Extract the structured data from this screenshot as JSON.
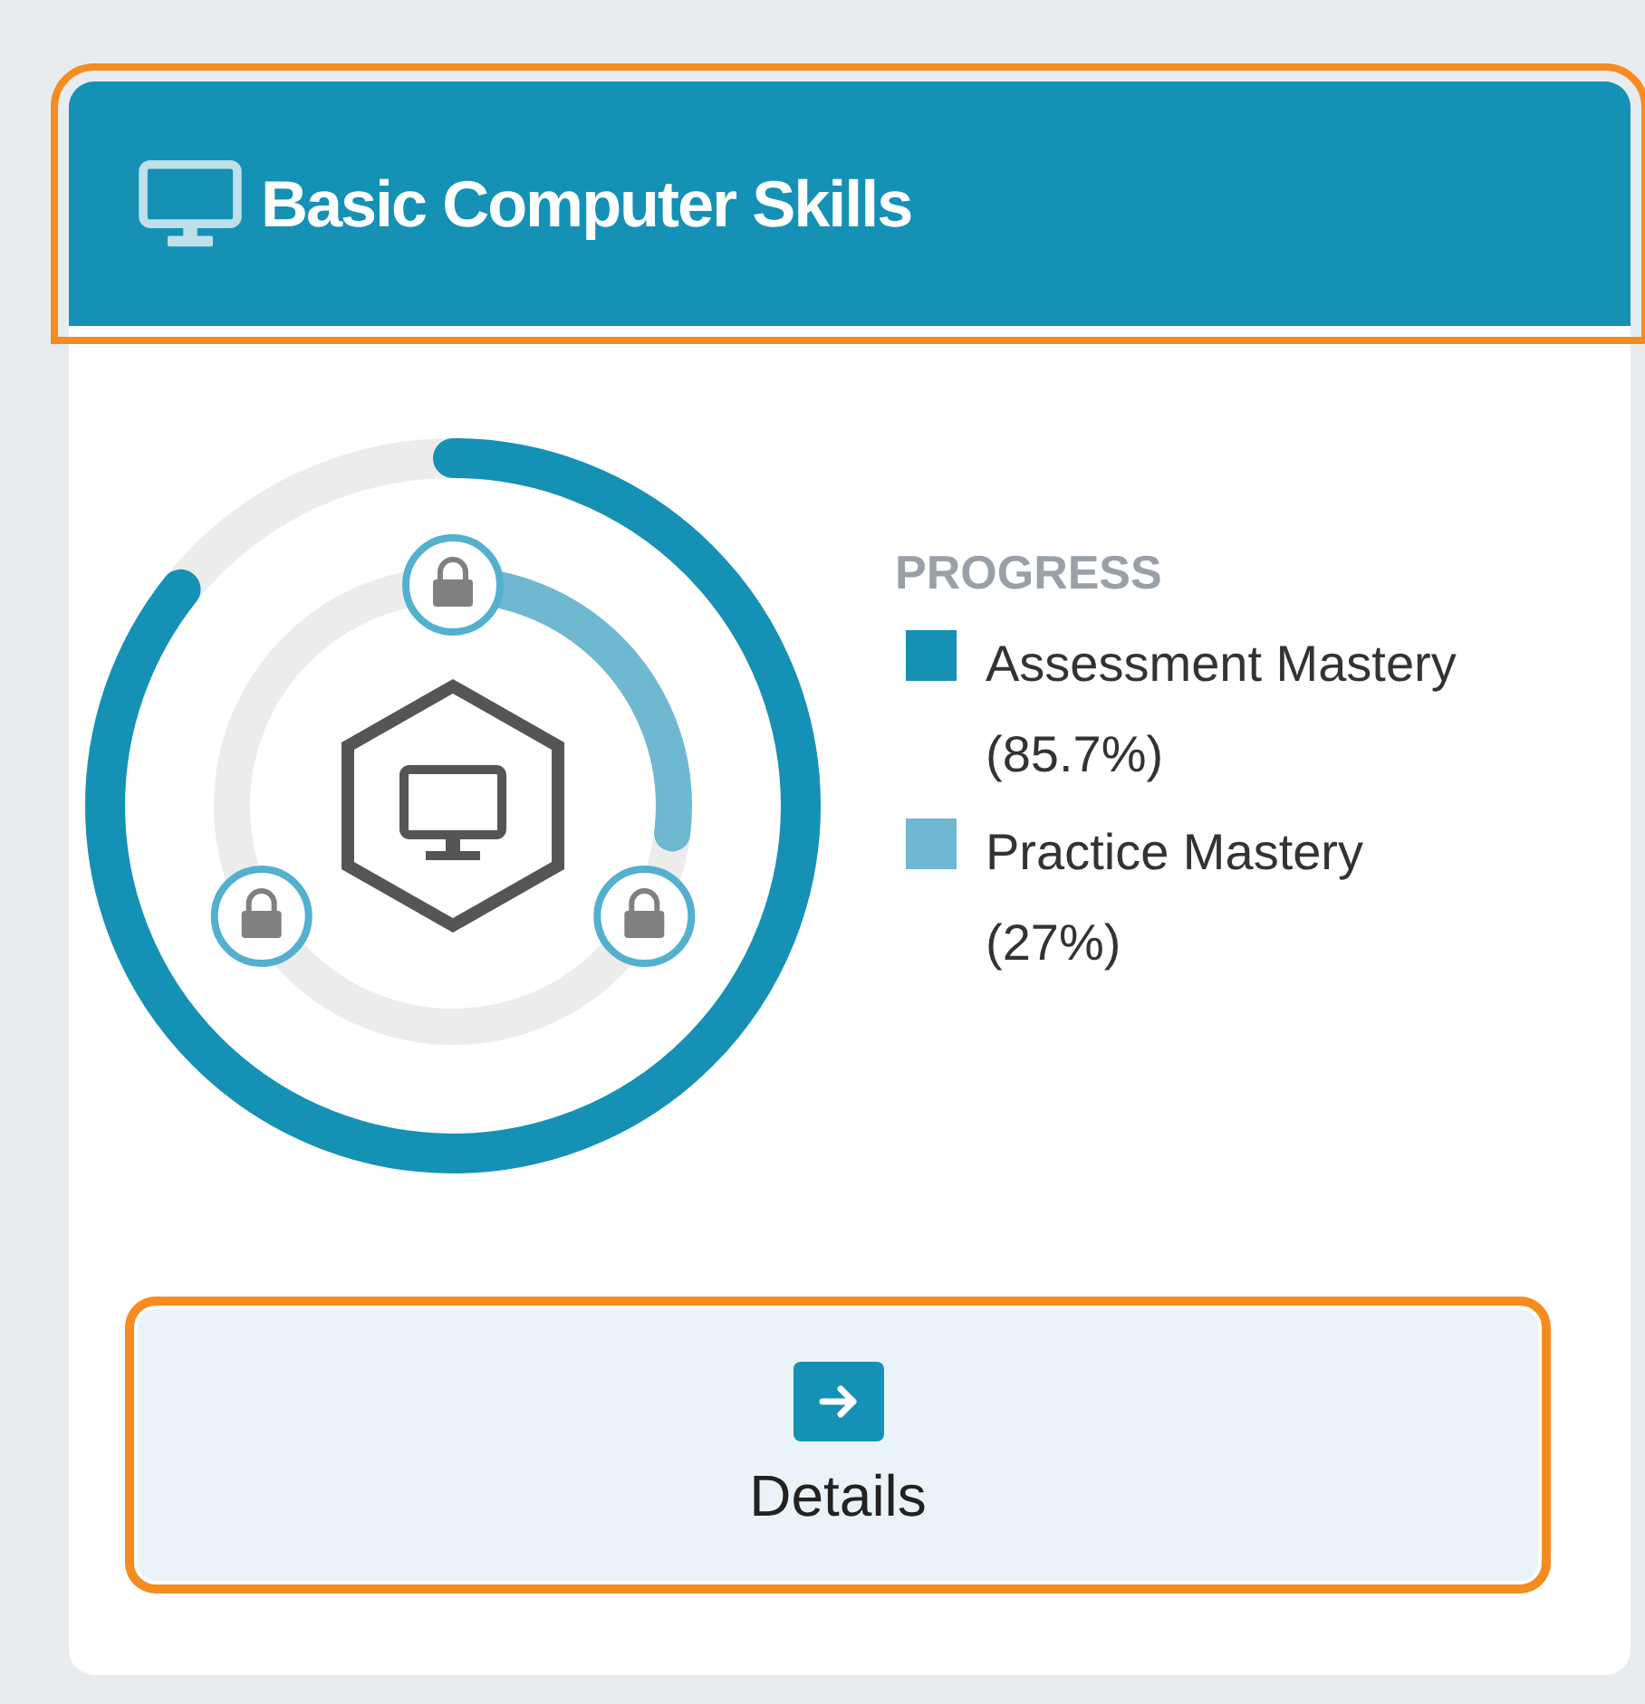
{
  "header": {
    "title": "Basic Computer Skills",
    "focused": true
  },
  "progress": {
    "heading": "PROGRESS",
    "legend": [
      {
        "label": "Assessment Mastery",
        "value": "(85.7%)",
        "color": "#1591b5",
        "level": 0.857
      },
      {
        "label": "Practice Mastery",
        "value": "(27%)",
        "color": "#6fb8d2",
        "level": 0.27
      }
    ]
  },
  "milestones": [
    {
      "locked": true
    },
    {
      "locked": true
    },
    {
      "locked": true
    }
  ],
  "details_button": {
    "label": "Details",
    "focused": true
  }
}
